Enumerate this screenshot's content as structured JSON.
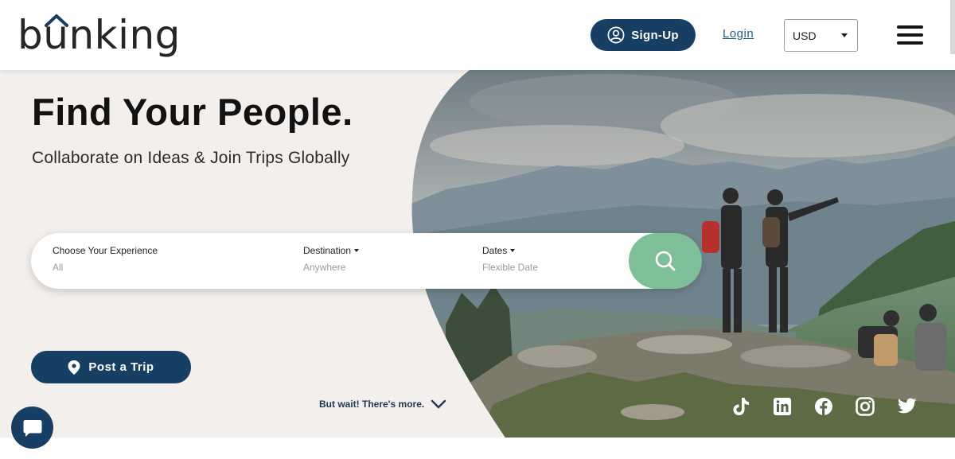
{
  "header": {
    "logo_text": "bunking",
    "signup_label": "Sign-Up",
    "login_label": "Login",
    "currency_value": "USD",
    "brand_color": "#173f63"
  },
  "hero": {
    "title": "Find Your People.",
    "subtitle": "Collaborate on Ideas & Join Trips Globally",
    "search": {
      "experience_label": "Choose Your Experience",
      "experience_value": "All",
      "destination_label": "Destination",
      "destination_value": "Anywhere",
      "dates_label": "Dates",
      "dates_value": "Flexible Date",
      "search_button_color": "#7fbf98"
    },
    "post_trip_label": "Post a Trip",
    "more_label": "But wait! There's more."
  },
  "socials": [
    "tiktok-icon",
    "linkedin-icon",
    "facebook-icon",
    "instagram-icon",
    "twitter-icon"
  ],
  "chat": {
    "icon": "chat-bubble-icon"
  }
}
